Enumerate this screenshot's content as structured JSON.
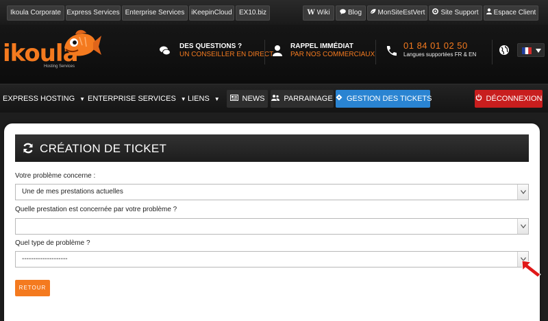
{
  "topbar": {
    "links": [
      {
        "label": "Ikoula Corporate",
        "icon": ""
      },
      {
        "label": "Express Services",
        "icon": ""
      },
      {
        "label": "Enterprise Services",
        "icon": ""
      },
      {
        "label": "iKeepinCloud",
        "icon": ""
      },
      {
        "label": "EX10.biz",
        "icon": ""
      }
    ],
    "right_links": [
      {
        "label": "Wiki",
        "icon": "W"
      },
      {
        "label": "Blog",
        "icon": "comment-icon"
      },
      {
        "label": "MonSiteEstVert",
        "icon": "leaf-icon"
      },
      {
        "label": "Site Support",
        "icon": "lifebuoy-icon"
      },
      {
        "label": "Espace Client",
        "icon": "user-icon"
      }
    ]
  },
  "header": {
    "logo": "ikoula",
    "logo_sub": "Hosting Services",
    "questions": {
      "line1": "DES QUESTIONS ?",
      "line2": "UN CONSEILLER EN DIRECT"
    },
    "callback": {
      "line1": "RAPPEL IMMÉDIAT",
      "line2": "PAR NOS COMMERCIAUX"
    },
    "phone": {
      "number": "01 84 01 02 50",
      "langs": "Langues supportées FR & EN"
    }
  },
  "nav": {
    "items": [
      {
        "label": "EXPRESS HOSTING"
      },
      {
        "label": "ENTERPRISE SERVICES"
      },
      {
        "label": "LIENS"
      }
    ],
    "news": "NEWS",
    "parrainage": "PARRAINAGE",
    "tickets": "GESTION DES TICKETS",
    "logout": "DÉCONNEXION"
  },
  "colors": {
    "accent": "#f47a1f",
    "tickets_blue": "#2a84d2",
    "logout_red": "#c81e1e",
    "dark_bg": "#1e1e1e"
  },
  "form": {
    "title": "CRÉATION DE TICKET",
    "q1_label": "Votre problème concerne :",
    "q1_value": "Une de mes prestations actuelles",
    "q2_label": "Quelle prestation est concernée par votre problème ?",
    "q2_value": "",
    "q3_label": "Quel type de problème ?",
    "q3_value": "--------------------",
    "back_button": "RETOUR"
  }
}
